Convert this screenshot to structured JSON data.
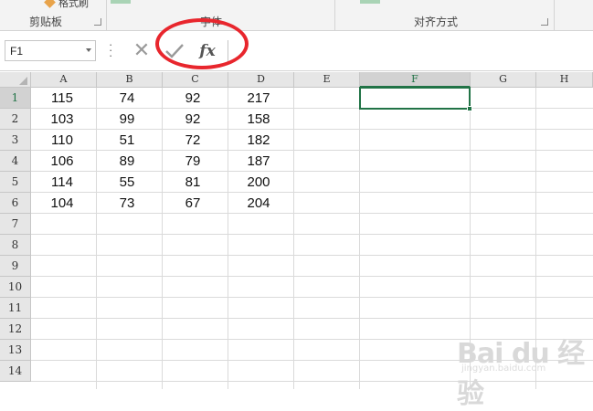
{
  "ribbon": {
    "brush_label": "格式刷",
    "groups": [
      "剪贴板",
      "字体",
      "对齐方式"
    ]
  },
  "formula_bar": {
    "name_box": "F1",
    "cancel_icon": "cancel-icon",
    "enter_icon": "check-icon",
    "fx_label": "fx",
    "formula_value": ""
  },
  "columns": [
    "A",
    "B",
    "C",
    "D",
    "E",
    "F",
    "G",
    "H"
  ],
  "selected_column": "F",
  "rows": [
    "1",
    "2",
    "3",
    "4",
    "5",
    "6",
    "7",
    "8",
    "9",
    "10",
    "11",
    "12",
    "13",
    "14"
  ],
  "selected_row": "1",
  "cells": [
    [
      "115",
      "74",
      "92",
      "217"
    ],
    [
      "103",
      "99",
      "92",
      "158"
    ],
    [
      "110",
      "51",
      "72",
      "182"
    ],
    [
      "106",
      "89",
      "79",
      "187"
    ],
    [
      "114",
      "55",
      "81",
      "200"
    ],
    [
      "104",
      "73",
      "67",
      "204"
    ]
  ],
  "watermark": {
    "text": "Bai du 经验",
    "sub": "jingyan.baidu.com"
  },
  "colors": {
    "accent": "#217346",
    "highlight": "#e8262d"
  }
}
